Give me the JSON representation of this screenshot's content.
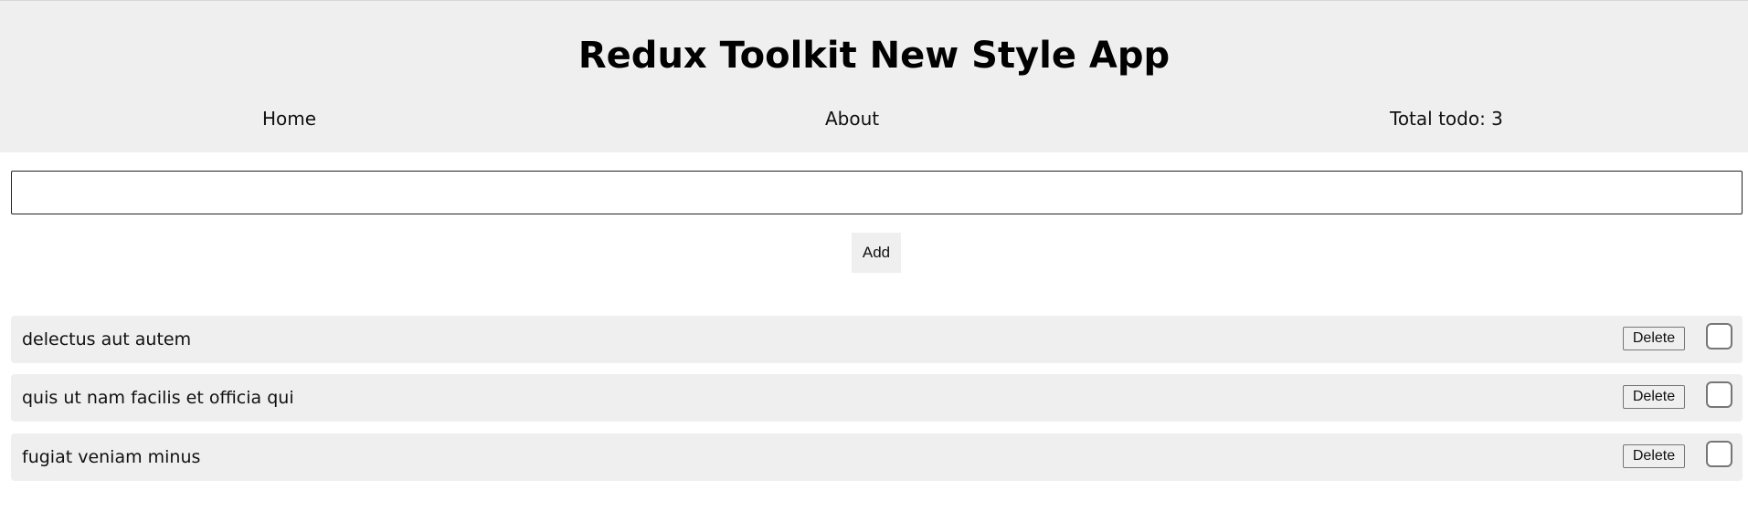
{
  "header": {
    "title": "Redux Toolkit New Style App",
    "nav": {
      "home": "Home",
      "about": "About",
      "total": "Total todo: 3"
    }
  },
  "form": {
    "input_value": "",
    "input_placeholder": "",
    "add_label": "Add"
  },
  "todos": [
    {
      "text": "delectus aut autem",
      "delete_label": "Delete",
      "completed": false
    },
    {
      "text": "quis ut nam facilis et officia qui",
      "delete_label": "Delete",
      "completed": false
    },
    {
      "text": "fugiat veniam minus",
      "delete_label": "Delete",
      "completed": false
    }
  ],
  "colors": {
    "header_bg": "#efefef",
    "item_bg": "#efefef",
    "text": "#111111"
  }
}
